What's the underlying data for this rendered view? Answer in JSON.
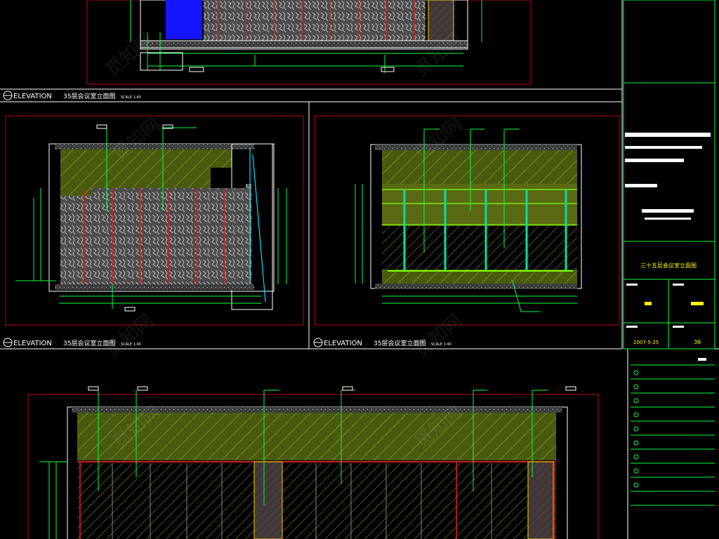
{
  "drawing": {
    "background": "#000000",
    "colors": {
      "frame": "#ffffff",
      "border": "#c0001a",
      "dimension": "#00ff40",
      "hatch_fill": "#4a5a10",
      "wall_panel": "#555555",
      "glass": "#1010ff",
      "accent": "#ffff00"
    },
    "views": [
      {
        "label": "ELEVATION",
        "title": "35层会议室立面图",
        "scale": "SCALE 1:40"
      },
      {
        "label": "ELEVATION",
        "title": "35层会议室立面图",
        "scale": "SCALE 1:40"
      },
      {
        "label": "ELEVATION",
        "title": "35层会议室立面图",
        "scale": "SCALE 1:40"
      }
    ],
    "title_block": {
      "project_name": "三十五层会议室立面图",
      "date": "2007-5-25",
      "sheet_no": "36"
    },
    "watermark_text": "觅知网",
    "icons": [
      "elevation-marker-icon",
      "revision-marker-icon"
    ]
  }
}
